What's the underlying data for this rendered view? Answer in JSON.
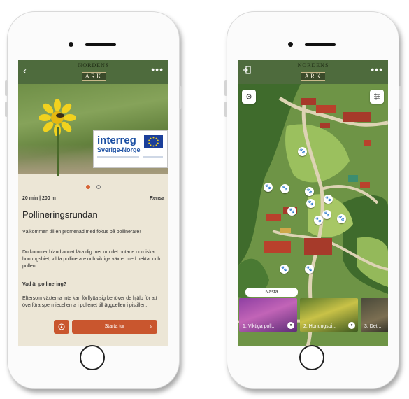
{
  "colors": {
    "header_green": "#4e6b3d",
    "accent_orange": "#c9562e",
    "paper_beige": "#ece6d6",
    "interreg_blue": "#1b4fa3"
  },
  "left_screen": {
    "header": {
      "logo_line1": "NORDENS",
      "logo_line2": "ARK",
      "back_icon": "chevron-left-icon",
      "more_icon": "more-dots-icon"
    },
    "hero": {
      "badge_line1": "interreg",
      "badge_line2": "Sverige-Norge"
    },
    "carousel": {
      "current": 1,
      "total": 2
    },
    "meta": "20 min | 200 m",
    "meta_right": "Rensa",
    "title": "Pollineringsrundan",
    "paragraphs": {
      "p1": "Välkommen till en promenad med fokus på pollinerare!",
      "p2": "Du kommer bland annat lära dig mer om det hotade nordiska honungsbiet, vilda pollinerare och viktiga växter med nektar och pollen.",
      "p3": "Vad är pollinering?",
      "p4": "Eftersom växterna inte kan förflytta sig behöver de hjälp för att överföra spermiecellerna i pollenet till äggcellen i pistillen."
    },
    "cta": {
      "label": "Starta tur",
      "icon": "compass-icon"
    }
  },
  "right_screen": {
    "header": {
      "logo_line1": "NORDENS",
      "logo_line2": "ARK",
      "exit_icon": "exit-icon",
      "more_icon": "more-dots-icon"
    },
    "map": {
      "locate_icon": "location-icon",
      "filter_icon": "filter-icon",
      "poi_icon": "paw-icon"
    },
    "next_label": "Nästa",
    "cards": [
      {
        "caption": "1. Viktiga poll..."
      },
      {
        "caption": "2. Honungsbi..."
      },
      {
        "caption": "3. Det ..."
      }
    ]
  }
}
